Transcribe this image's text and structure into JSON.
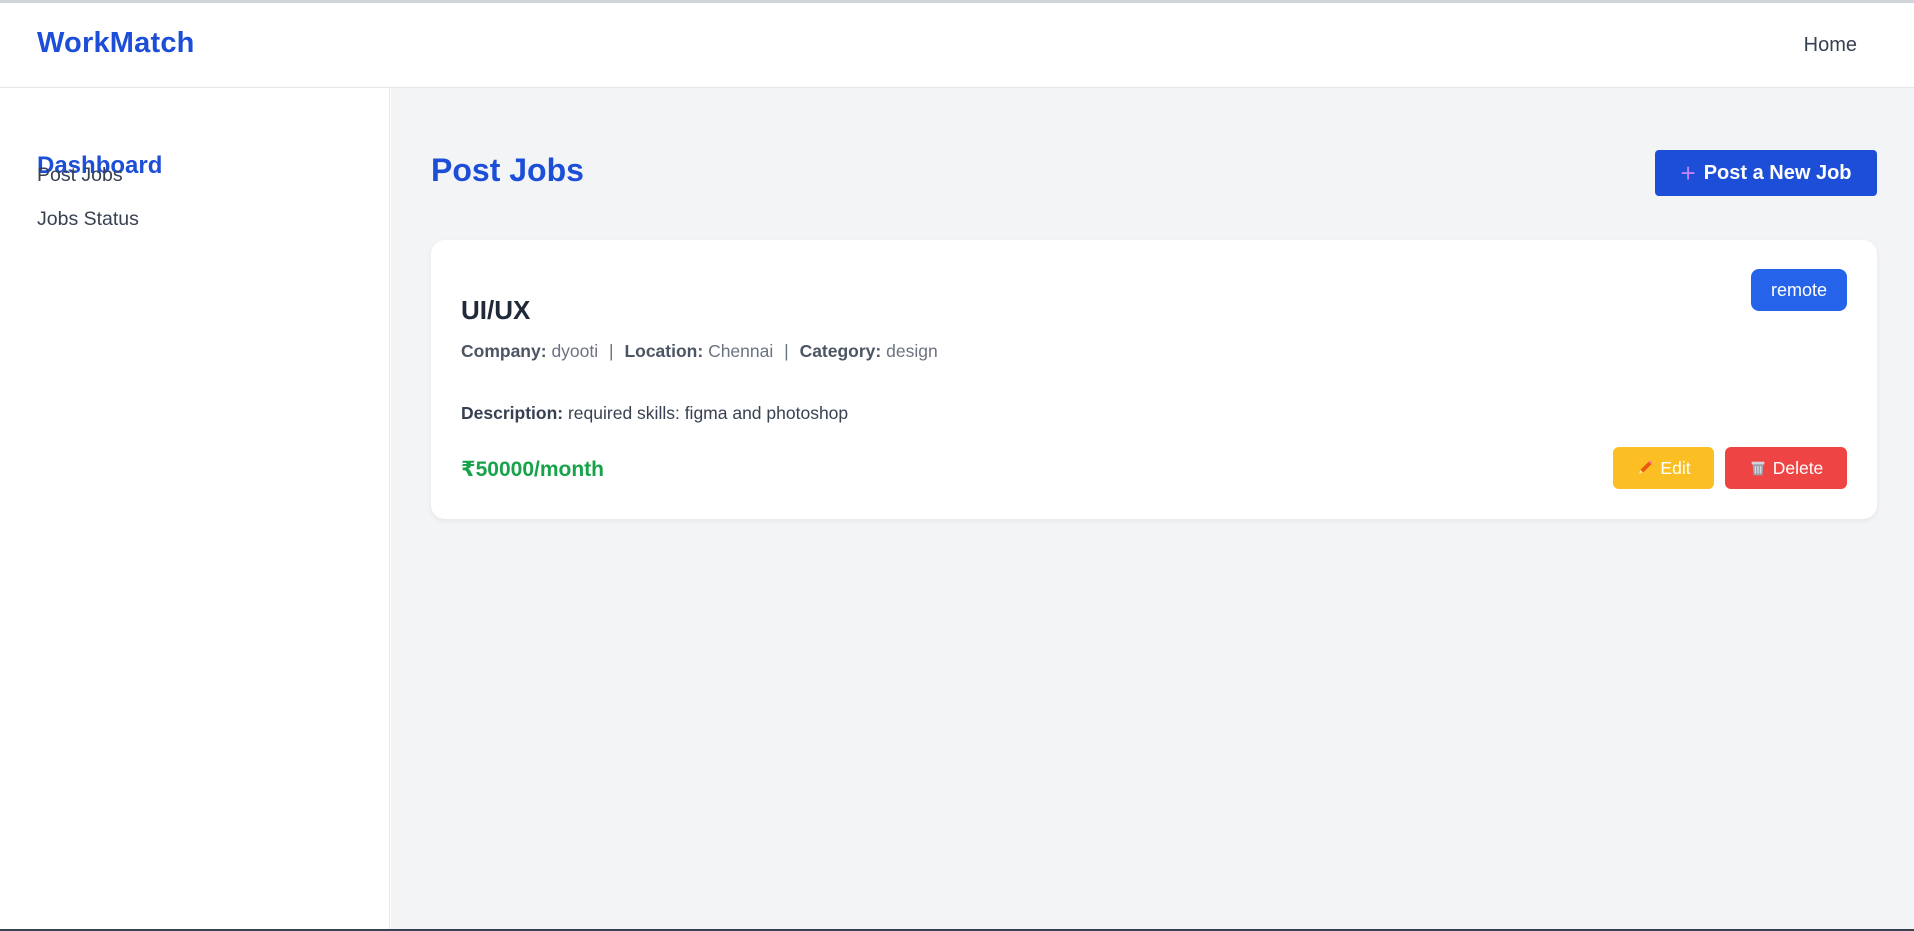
{
  "header": {
    "brand": "WorkMatch",
    "nav_home": "Home"
  },
  "sidebar": {
    "title": "Dashboard",
    "items": [
      {
        "label": "Post Jobs"
      },
      {
        "label": "Jobs Status"
      }
    ]
  },
  "main": {
    "page_title": "Post Jobs",
    "post_button": {
      "icon": "plus-icon",
      "label": "Post a New Job"
    }
  },
  "job": {
    "title": "UI/UX",
    "type_badge": "remote",
    "company_label": "Company:",
    "company": "dyooti",
    "location_label": "Location:",
    "location": "Chennai",
    "category_label": "Category:",
    "category": "design",
    "description_label": "Description:",
    "description": "required skills: figma and photoshop",
    "salary": "₹50000/month",
    "edit_label": "Edit",
    "delete_label": "Delete"
  },
  "colors": {
    "brand": "#1d4ed8",
    "salary": "#16a34a",
    "edit": "#fbbf24",
    "delete": "#ef4444",
    "badge": "#2563eb"
  }
}
